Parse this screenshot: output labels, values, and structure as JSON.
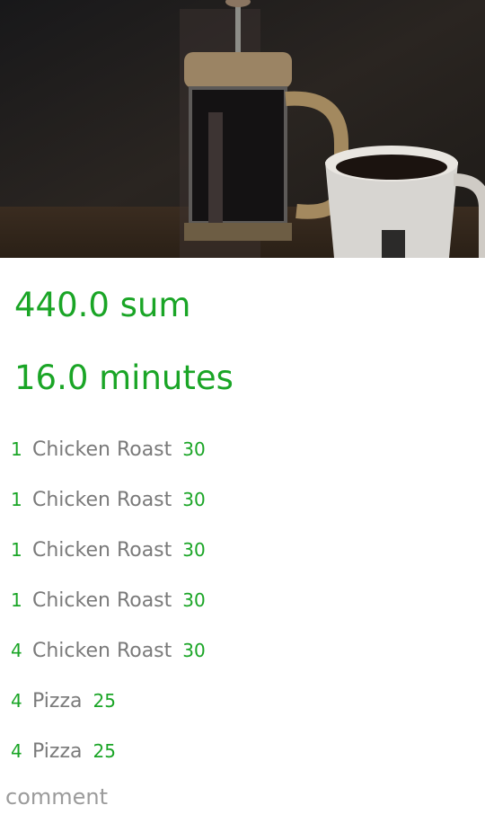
{
  "summary": {
    "total": "440.0 sum",
    "duration": "16.0 minutes"
  },
  "items": [
    {
      "qty": "1",
      "name": "Chicken Roast",
      "price": "30"
    },
    {
      "qty": "1",
      "name": "Chicken Roast",
      "price": "30"
    },
    {
      "qty": "1",
      "name": "Chicken Roast",
      "price": "30"
    },
    {
      "qty": "1",
      "name": "Chicken Roast",
      "price": "30"
    },
    {
      "qty": "4",
      "name": "Chicken Roast",
      "price": "30"
    },
    {
      "qty": "4",
      "name": "Pizza",
      "price": "25"
    },
    {
      "qty": "4",
      "name": "Pizza",
      "price": "25"
    }
  ],
  "comment": {
    "placeholder": "comment"
  },
  "colors": {
    "accent": "#1aa526",
    "muted": "#7a7a7a"
  }
}
